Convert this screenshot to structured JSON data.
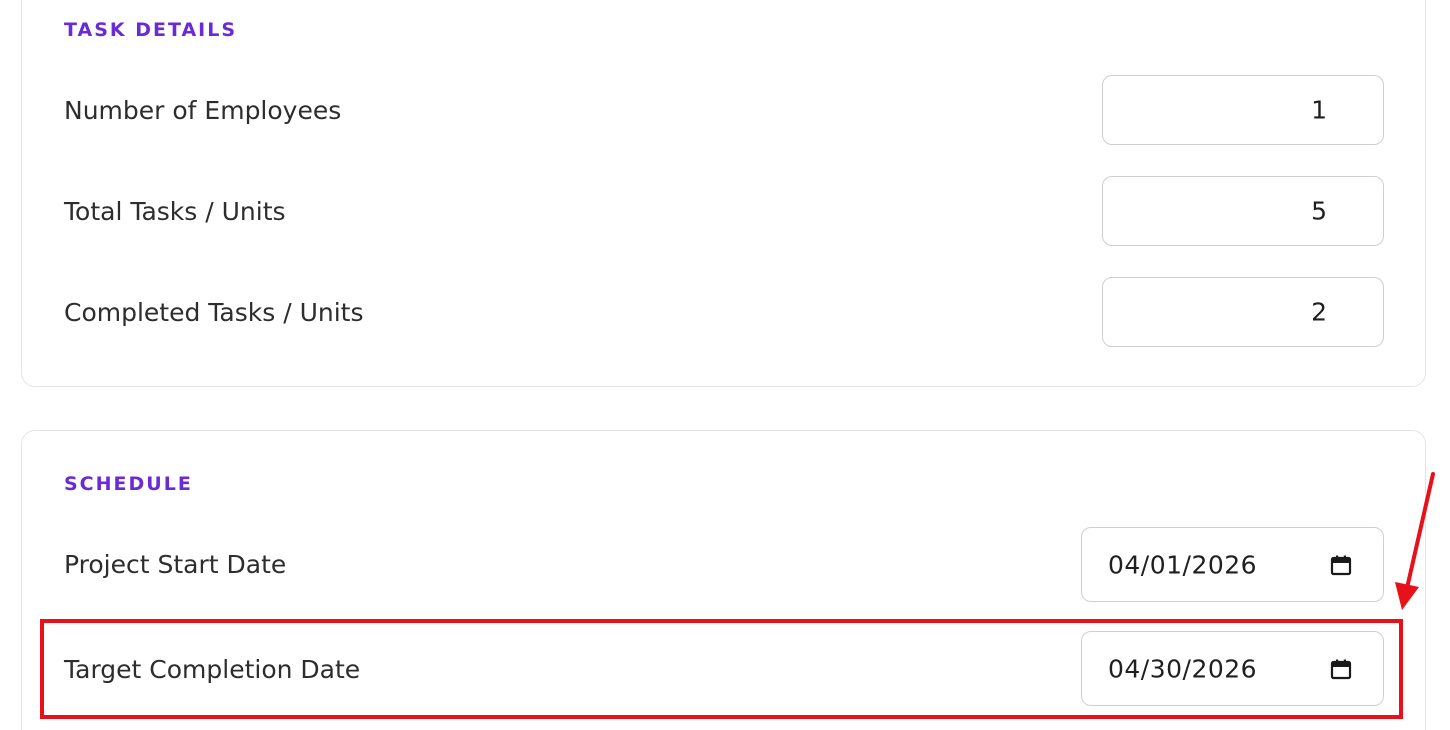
{
  "task_details": {
    "title": "TASK DETAILS",
    "rows": [
      {
        "label": "Number of Employees",
        "value": "1"
      },
      {
        "label": "Total Tasks / Units",
        "value": "5"
      },
      {
        "label": "Completed Tasks / Units",
        "value": "2"
      }
    ]
  },
  "schedule": {
    "title": "SCHEDULE",
    "rows": [
      {
        "label": "Project Start Date",
        "value": "04/01/2026"
      },
      {
        "label": "Target Completion Date",
        "value": "04/30/2026"
      }
    ]
  },
  "icons": {
    "date_picker": "calendar-icon"
  },
  "colors": {
    "section_title": "#6a2bd6",
    "highlight": "#e8111a",
    "text": "#2d2d2d",
    "input_border": "#cfcfcf"
  }
}
